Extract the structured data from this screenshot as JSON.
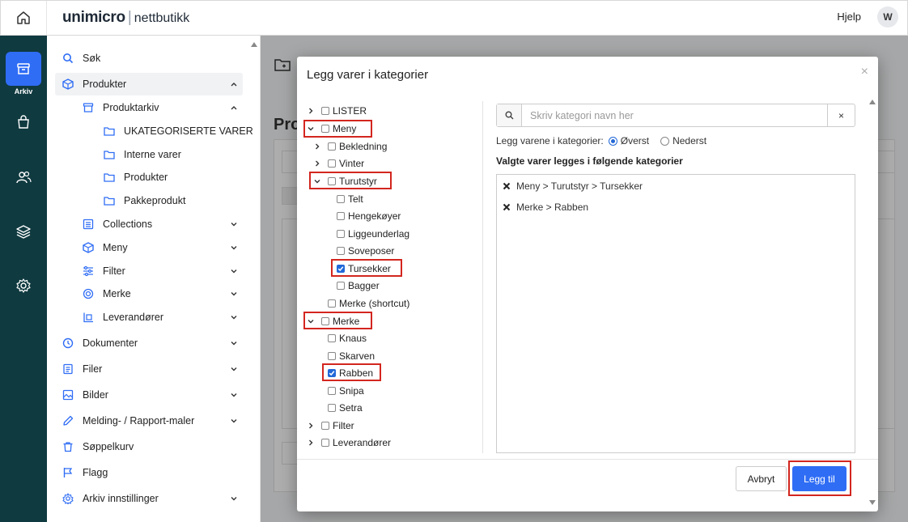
{
  "header": {
    "brand": "unimicro",
    "separator": "|",
    "product": "nettbutikk",
    "help_label": "Hjelp",
    "avatar_initial": "W"
  },
  "rail": {
    "active_label": "Arkiv",
    "items": [
      "archive-icon",
      "bag-icon",
      "users-icon",
      "layers-icon",
      "settings-icon"
    ],
    "accent": "#2f6df5",
    "background": "#0f3a40"
  },
  "sidebar": {
    "items": [
      {
        "label": "Søk",
        "icon": "search-icon"
      },
      {
        "label": "Produkter",
        "icon": "cube-icon",
        "expanded": true
      },
      {
        "label": "Produktarkiv",
        "icon": "archive-icon",
        "expanded": true
      },
      {
        "label": "UKATEGORISERTE VARER",
        "icon": "folder-icon"
      },
      {
        "label": "Interne varer",
        "icon": "folder-icon"
      },
      {
        "label": "Produkter",
        "icon": "folder-icon"
      },
      {
        "label": "Pakkeprodukt",
        "icon": "folder-icon"
      },
      {
        "label": "Collections",
        "icon": "list-icon"
      },
      {
        "label": "Meny",
        "icon": "cube-icon"
      },
      {
        "label": "Filter",
        "icon": "sliders-icon"
      },
      {
        "label": "Merke",
        "icon": "badge-icon"
      },
      {
        "label": "Leverandører",
        "icon": "supplier-icon"
      },
      {
        "label": "Dokumenter",
        "icon": "document-icon"
      },
      {
        "label": "Filer",
        "icon": "file-icon"
      },
      {
        "label": "Bilder",
        "icon": "image-icon"
      },
      {
        "label": "Melding- / Rapport-maler",
        "icon": "edit-icon"
      },
      {
        "label": "Søppelkurv",
        "icon": "trash-icon"
      },
      {
        "label": "Flagg",
        "icon": "flag-icon"
      },
      {
        "label": "Arkiv innstillinger",
        "icon": "gear-icon"
      }
    ]
  },
  "background_page": {
    "title": "Pro"
  },
  "modal": {
    "title": "Legg varer i kategorier",
    "close": "×",
    "tree": [
      {
        "label": "LISTER",
        "toggle": "collapsed",
        "checked": false
      },
      {
        "label": "Meny",
        "toggle": "expanded",
        "checked": false
      },
      {
        "label": "Bekledning",
        "toggle": "collapsed",
        "checked": false
      },
      {
        "label": "Vinter",
        "toggle": "collapsed",
        "checked": false
      },
      {
        "label": "Turutstyr",
        "toggle": "expanded",
        "checked": false
      },
      {
        "label": "Telt",
        "toggle": "none",
        "checked": false
      },
      {
        "label": "Hengekøyer",
        "toggle": "none",
        "checked": false
      },
      {
        "label": "Liggeunderlag",
        "toggle": "none",
        "checked": false
      },
      {
        "label": "Soveposer",
        "toggle": "none",
        "checked": false
      },
      {
        "label": "Tursekker",
        "toggle": "none",
        "checked": true
      },
      {
        "label": "Bagger",
        "toggle": "none",
        "checked": false
      },
      {
        "label": "Merke (shortcut)",
        "toggle": "none",
        "checked": false
      },
      {
        "label": "Merke",
        "toggle": "expanded",
        "checked": false
      },
      {
        "label": "Knaus",
        "toggle": "none",
        "checked": false
      },
      {
        "label": "Skarven",
        "toggle": "none",
        "checked": false
      },
      {
        "label": "Rabben",
        "toggle": "none",
        "checked": true
      },
      {
        "label": "Snipa",
        "toggle": "none",
        "checked": false
      },
      {
        "label": "Setra",
        "toggle": "none",
        "checked": false
      },
      {
        "label": "Filter",
        "toggle": "collapsed",
        "checked": false
      },
      {
        "label": "Leverandører",
        "toggle": "collapsed",
        "checked": false
      }
    ],
    "search_placeholder": "Skriv kategori navn her",
    "search_value": "",
    "clear_label": "×",
    "placement_label": "Legg varene i kategorier:",
    "placement_options": [
      {
        "label": "Øverst",
        "selected": true
      },
      {
        "label": "Nederst",
        "selected": false
      }
    ],
    "selected_heading": "Valgte varer legges i følgende kategorier",
    "selected_paths": [
      "Meny > Turutstyr > Tursekker",
      "Merke > Rabben"
    ],
    "cancel_label": "Avbryt",
    "add_label": "Legg til",
    "highlight_color": "#d3261f"
  }
}
